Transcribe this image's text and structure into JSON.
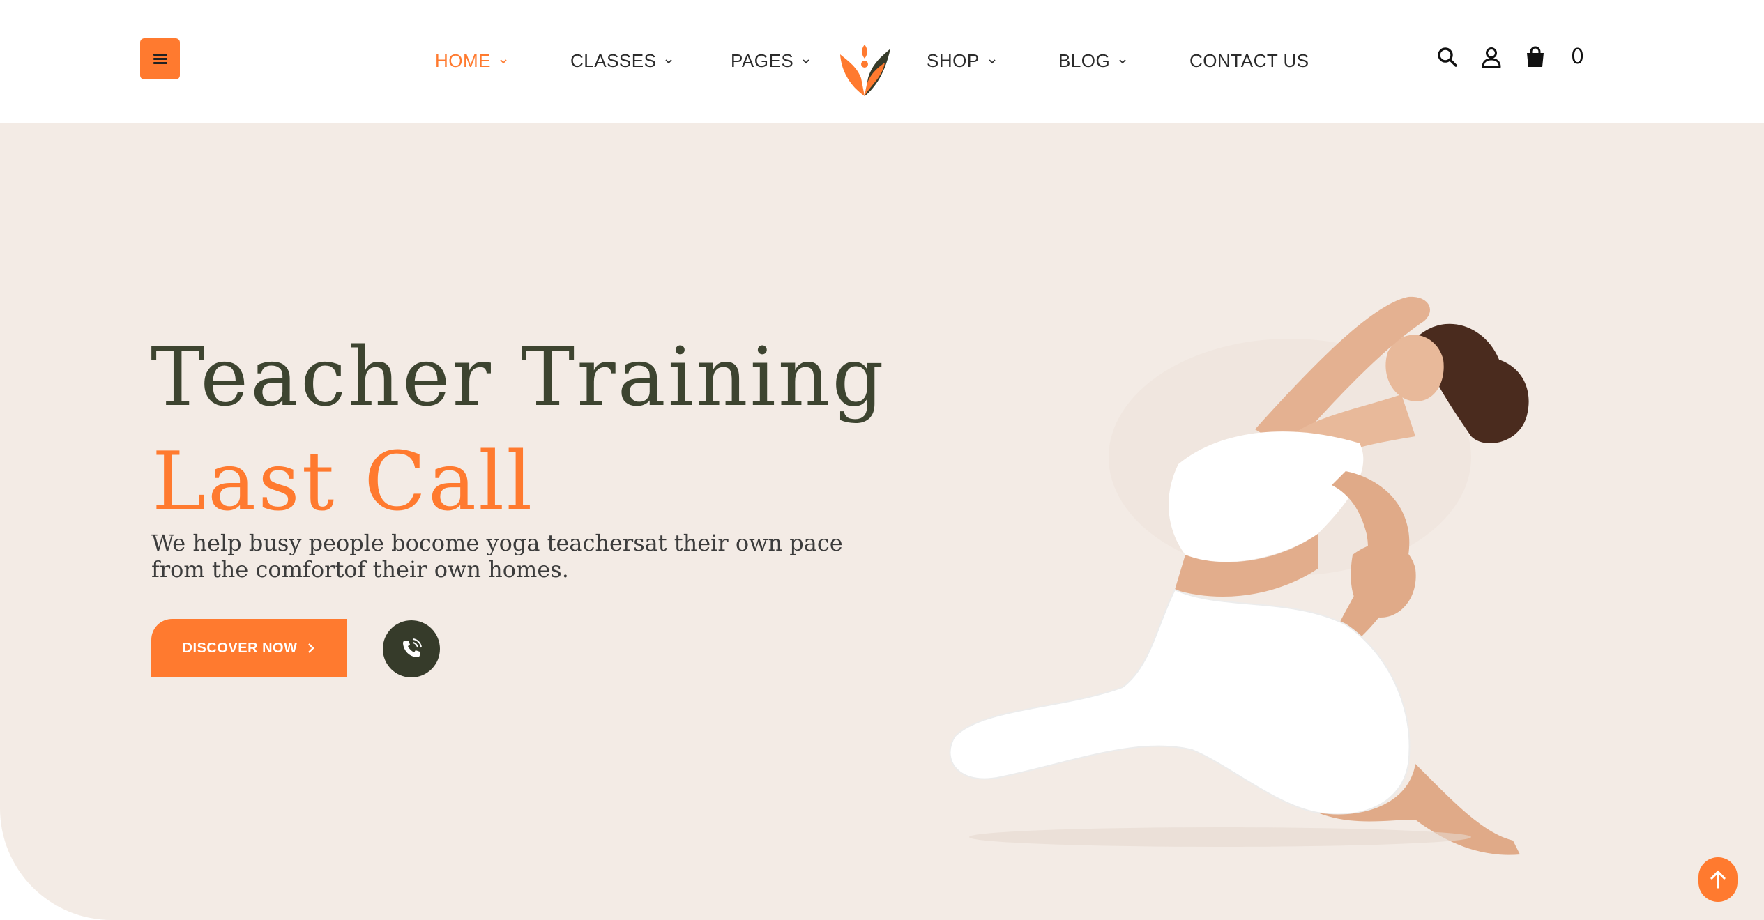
{
  "header": {
    "nav": [
      {
        "label": "HOME",
        "has_dropdown": true,
        "active": true
      },
      {
        "label": "CLASSES",
        "has_dropdown": true,
        "active": false
      },
      {
        "label": "PAGES",
        "has_dropdown": true,
        "active": false
      },
      {
        "label": "SHOP",
        "has_dropdown": true,
        "active": false
      },
      {
        "label": "BLOG",
        "has_dropdown": true,
        "active": false
      },
      {
        "label": "CONTACT US",
        "has_dropdown": false,
        "active": false
      }
    ],
    "icons": [
      "menu-icon",
      "search-icon",
      "user-icon",
      "shopping-bag-icon"
    ],
    "cart_count": "0"
  },
  "hero": {
    "title_line1": "Teacher Training",
    "title_line2": "Last Call",
    "subtitle": "We help busy people bocome yoga teachersat their own pace from the comfortof their own homes.",
    "cta_label": "DISCOVER NOW",
    "phone_icon": "phone-call-icon"
  },
  "colors": {
    "accent": "#ff7a2f",
    "dark": "#363b2a",
    "hero_bg": "#f3ebe5",
    "text": "#2b2b2b"
  }
}
